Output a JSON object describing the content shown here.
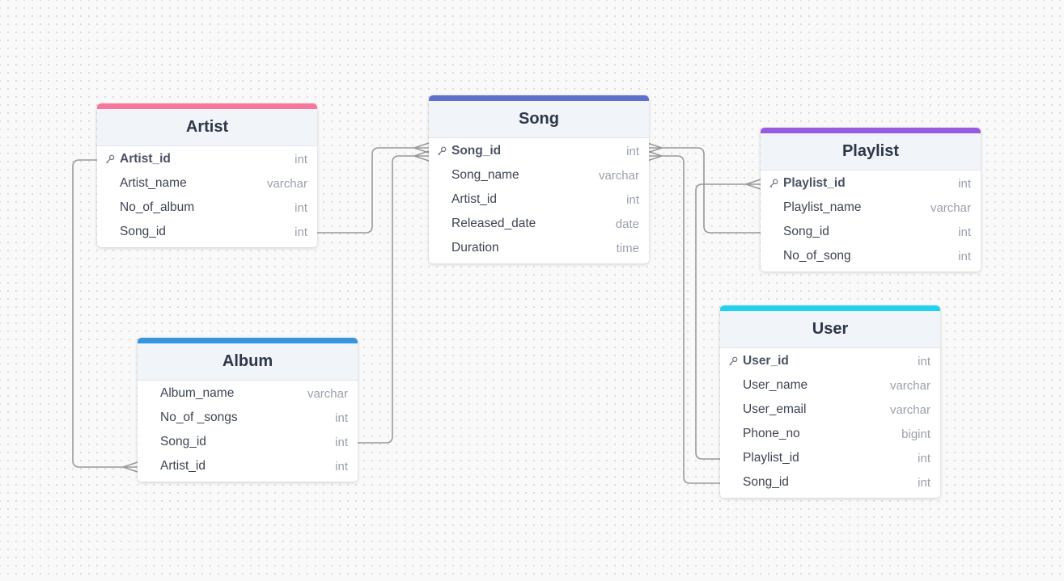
{
  "diagram": {
    "tables": {
      "artist": {
        "title": "Artist",
        "accent_color": "#f7769b",
        "fields": [
          {
            "name": "Artist_id",
            "type": "int",
            "primary_key": true
          },
          {
            "name": "Artist_name",
            "type": "varchar"
          },
          {
            "name": "No_of_album",
            "type": "int"
          },
          {
            "name": "Song_id",
            "type": "int"
          }
        ]
      },
      "song": {
        "title": "Song",
        "accent_color": "#5f6fcb",
        "fields": [
          {
            "name": "Song_id",
            "type": "int",
            "primary_key": true
          },
          {
            "name": "Song_name",
            "type": "varchar"
          },
          {
            "name": "Artist_id",
            "type": "int"
          },
          {
            "name": "Released_date",
            "type": "date"
          },
          {
            "name": "Duration",
            "type": "time"
          }
        ]
      },
      "playlist": {
        "title": "Playlist",
        "accent_color": "#975ae0",
        "fields": [
          {
            "name": "Playlist_id",
            "type": "int",
            "primary_key": true
          },
          {
            "name": "Playlist_name",
            "type": "varchar"
          },
          {
            "name": "Song_id",
            "type": "int"
          },
          {
            "name": "No_of_song",
            "type": "int"
          }
        ]
      },
      "album": {
        "title": "Album",
        "accent_color": "#3595dd",
        "fields": [
          {
            "name": "Album_name",
            "type": "varchar"
          },
          {
            "name": "No_of _songs",
            "type": "int"
          },
          {
            "name": "Song_id",
            "type": "int"
          },
          {
            "name": "Artist_id",
            "type": "int"
          }
        ]
      },
      "user": {
        "title": "User",
        "accent_color": "#21d2ee",
        "fields": [
          {
            "name": "User_id",
            "type": "int",
            "primary_key": true
          },
          {
            "name": "User_name",
            "type": "varchar"
          },
          {
            "name": "User_email",
            "type": "varchar"
          },
          {
            "name": "Phone_no",
            "type": "bigint"
          },
          {
            "name": "Playlist_id",
            "type": "int"
          },
          {
            "name": "Song_id",
            "type": "int"
          }
        ]
      }
    },
    "relationships": [
      {
        "from": "Artist.Song_id",
        "to": "Song.Song_id",
        "cardinality": "one-to-many"
      },
      {
        "from": "Album.Song_id",
        "to": "Song.Song_id",
        "cardinality": "one-to-many"
      },
      {
        "from": "Artist.Artist_id",
        "to": "Album.Artist_id",
        "cardinality": "one-to-many"
      },
      {
        "from": "Playlist.Song_id",
        "to": "Song.Song_id",
        "cardinality": "one-to-many"
      },
      {
        "from": "User.Song_id",
        "to": "Song.Song_id",
        "cardinality": "one-to-many"
      },
      {
        "from": "User.Playlist_id",
        "to": "Playlist.Playlist_id",
        "cardinality": "one-to-many"
      }
    ]
  }
}
